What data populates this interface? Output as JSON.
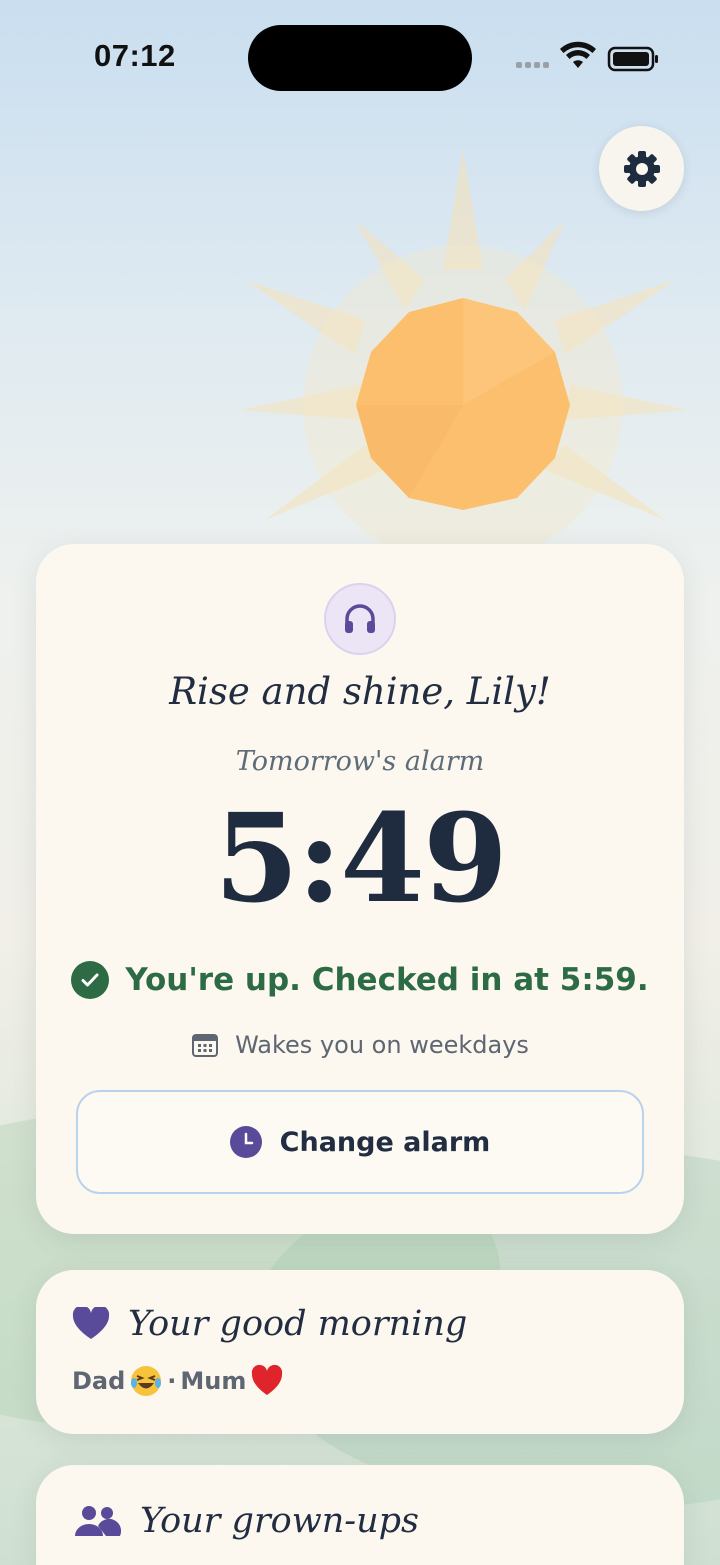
{
  "status_bar": {
    "time": "07:12",
    "icons": [
      "cellular-signal-icon",
      "wifi-icon",
      "battery-icon"
    ]
  },
  "settings": {
    "icon": "gear-icon"
  },
  "alarm_card": {
    "icon": "headphones-icon",
    "greeting": "Rise and shine, Lily!",
    "alarm_label": "Tomorrow's alarm",
    "alarm_time": "5:49",
    "checked_in_text": "You're up. Checked in at 5:59.",
    "schedule_text": "Wakes you on weekdays",
    "change_button_label": "Change alarm"
  },
  "good_morning_card": {
    "title": "Your good morning",
    "icon": "heart-icon",
    "messages": [
      {
        "name": "Dad",
        "emoji": "laughing-tears-emoji"
      },
      {
        "separator": "·"
      },
      {
        "name": "Mum",
        "emoji": "red-heart-emoji"
      }
    ]
  },
  "grownups_card": {
    "title": "Your grown-ups",
    "icon": "people-icon"
  },
  "colors": {
    "success_green": "#2d6b45",
    "accent_purple": "#5a4a9a",
    "ink": "#222d42",
    "card_bg": "#fcf8ef"
  }
}
